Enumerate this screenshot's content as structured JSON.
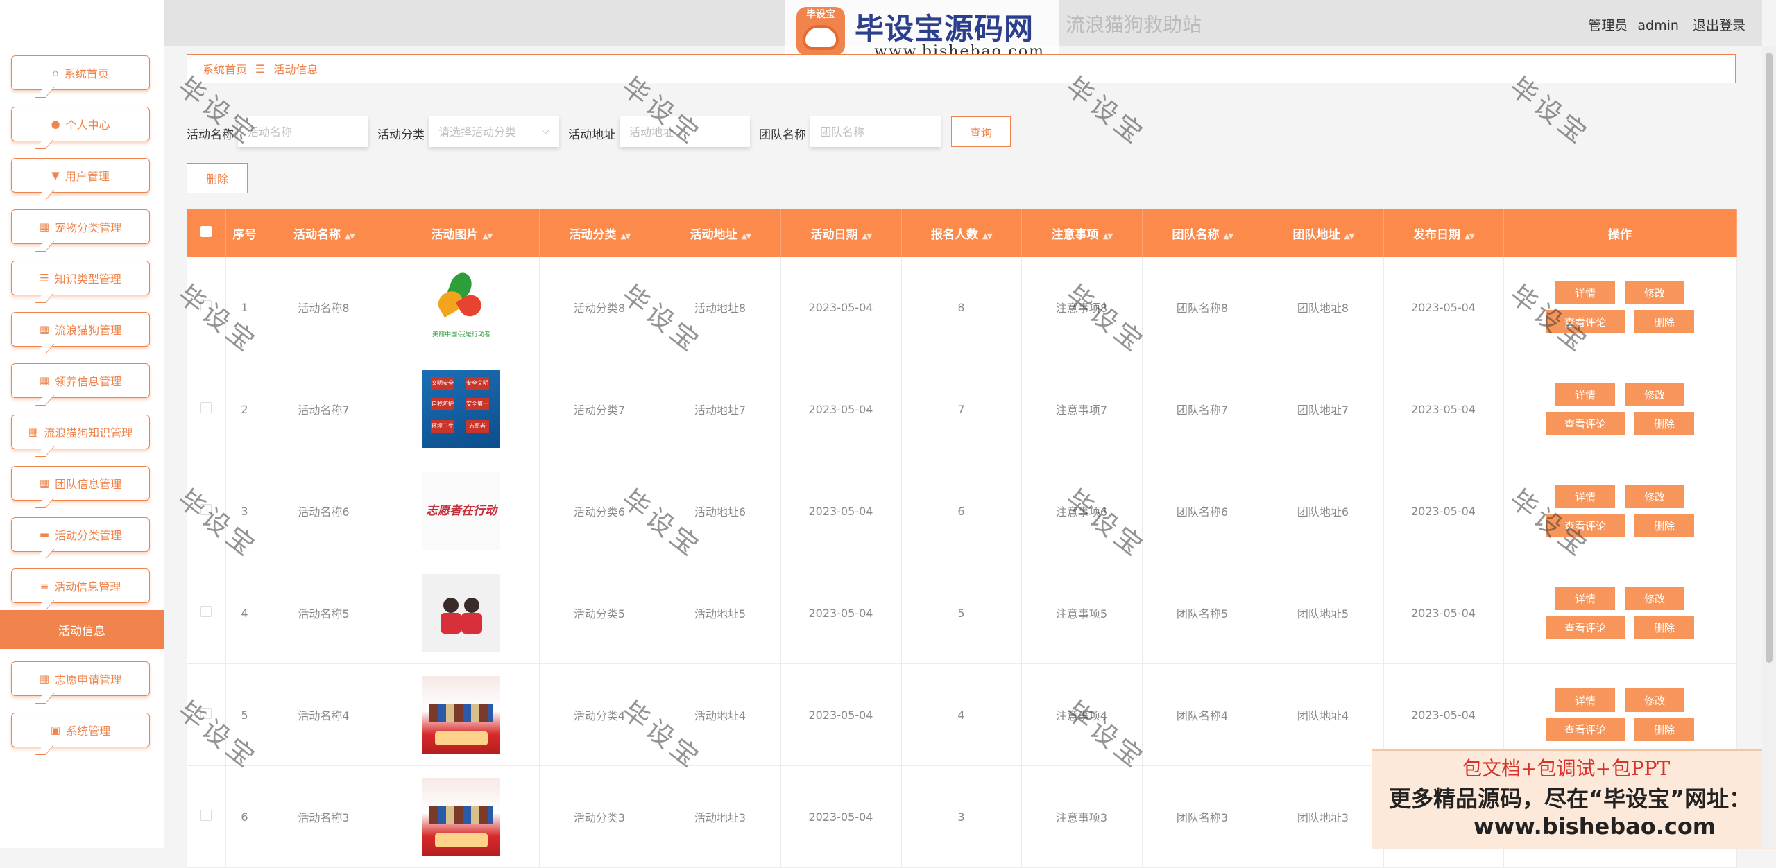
{
  "header": {
    "site_title": "流浪猫狗救助站",
    "role_label": "管理员",
    "username": "admin",
    "logout_label": "退出登录"
  },
  "watermark_logo": {
    "badge_text": "毕设宝",
    "name": "毕设宝源码网",
    "url": "www.bishebao.com"
  },
  "sidebar": {
    "items": [
      {
        "label": "系统首页",
        "icon": "home-icon",
        "glyph": "⌂"
      },
      {
        "label": "个人中心",
        "icon": "user-icon",
        "glyph": "●"
      },
      {
        "label": "用户管理",
        "icon": "users-icon",
        "glyph": "▼"
      },
      {
        "label": "宠物分类管理",
        "icon": "grid-icon",
        "glyph": "▦"
      },
      {
        "label": "知识类型管理",
        "icon": "sliders-icon",
        "glyph": "☰"
      },
      {
        "label": "流浪猫狗管理",
        "icon": "grid-icon",
        "glyph": "▦"
      },
      {
        "label": "领养信息管理",
        "icon": "grid-icon",
        "glyph": "▦"
      },
      {
        "label": "流浪猫狗知识管理",
        "icon": "grid-icon",
        "glyph": "▦"
      },
      {
        "label": "团队信息管理",
        "icon": "grid-icon",
        "glyph": "▦"
      },
      {
        "label": "活动分类管理",
        "icon": "monitor-icon",
        "glyph": "▬"
      },
      {
        "label": "活动信息管理",
        "icon": "list-icon",
        "glyph": "≡"
      },
      {
        "label": "志愿申请管理",
        "icon": "grid-icon",
        "glyph": "▦"
      },
      {
        "label": "系统管理",
        "icon": "clipboard-icon",
        "glyph": "▣"
      }
    ],
    "active_sub": "活动信息"
  },
  "breadcrumb": {
    "home": "系统首页",
    "separator": "☰",
    "current": "活动信息"
  },
  "search": {
    "name_label": "活动名称",
    "name_placeholder": "活动名称",
    "category_label": "活动分类",
    "category_placeholder": "请选择活动分类",
    "address_label": "活动地址",
    "address_placeholder": "活动地址",
    "team_label": "团队名称",
    "team_placeholder": "团队名称",
    "query_button": "查询"
  },
  "toolbar": {
    "delete_label": "删除"
  },
  "table": {
    "headers": [
      "序号",
      "活动名称",
      "活动图片",
      "活动分类",
      "活动地址",
      "活动日期",
      "报名人数",
      "注意事项",
      "团队名称",
      "团队地址",
      "发布日期",
      "操作"
    ],
    "sortable": [
      false,
      true,
      true,
      true,
      true,
      true,
      true,
      true,
      true,
      true,
      true,
      false
    ],
    "actions": {
      "detail": "详情",
      "edit": "修改",
      "comments": "查看评论",
      "delete": "删除"
    },
    "rows": [
      {
        "no": "1",
        "name": "活动名称8",
        "image": "logo",
        "category": "活动分类8",
        "address": "活动地址8",
        "date": "2023-05-04",
        "count": "8",
        "notes": "注意事项8",
        "team": "团队名称8",
        "team_addr": "团队地址8",
        "publish": "2023-05-04"
      },
      {
        "no": "2",
        "name": "活动名称7",
        "image": "poster",
        "category": "活动分类7",
        "address": "活动地址7",
        "date": "2023-05-04",
        "count": "7",
        "notes": "注意事项7",
        "team": "团队名称7",
        "team_addr": "团队地址7",
        "publish": "2023-05-04"
      },
      {
        "no": "3",
        "name": "活动名称6",
        "image": "script",
        "category": "活动分类6",
        "address": "活动地址6",
        "date": "2023-05-04",
        "count": "6",
        "notes": "注意事项6",
        "team": "团队名称6",
        "team_addr": "团队地址6",
        "publish": "2023-05-04"
      },
      {
        "no": "4",
        "name": "活动名称5",
        "image": "kids",
        "category": "活动分类5",
        "address": "活动地址5",
        "date": "2023-05-04",
        "count": "5",
        "notes": "注意事项5",
        "team": "团队名称5",
        "team_addr": "团队地址5",
        "publish": "2023-05-04"
      },
      {
        "no": "5",
        "name": "活动名称4",
        "image": "red",
        "category": "活动分类4",
        "address": "活动地址4",
        "date": "2023-05-04",
        "count": "4",
        "notes": "注意事项4",
        "team": "团队名称4",
        "team_addr": "团队地址4",
        "publish": "2023-05-04"
      },
      {
        "no": "6",
        "name": "活动名称3",
        "image": "red",
        "category": "活动分类3",
        "address": "活动地址3",
        "date": "2023-05-04",
        "count": "3",
        "notes": "注意事项3",
        "team": "团队名称3",
        "team_addr": "团队地址3",
        "publish": "2023-05-04"
      }
    ]
  },
  "image_text": {
    "logo_caption": "美丽中国·我是行动者",
    "poster_cells": [
      "文明安全",
      "安全文明",
      "自我防护",
      "安全第一",
      "环境卫生",
      "志愿者"
    ],
    "script_text": "志愿者在行动"
  },
  "watermark_text": "毕设宝",
  "promo": {
    "line1": "包文档+包调试+包PPT",
    "line2": "更多精品源码，尽在“毕设宝”网址：",
    "line3": "www.bishebao.com"
  },
  "colors": {
    "accent": "#f0844c",
    "header_bg": "#fb8a4b",
    "button": "#f8955a"
  }
}
